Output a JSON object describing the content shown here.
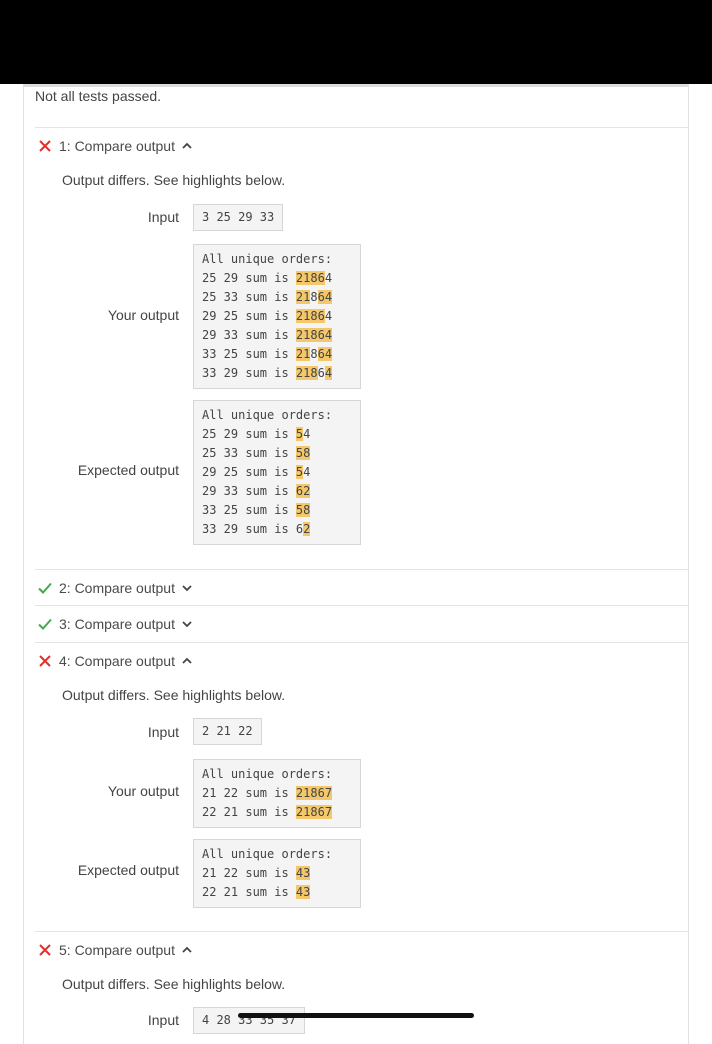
{
  "summary": "Not all tests passed.",
  "note_text": "Output differs. See highlights below.",
  "labels": {
    "input": "Input",
    "your_output": "Your output",
    "expected_output": "Expected output"
  },
  "colors": {
    "fail": "#e0302c",
    "pass": "#3fae4a",
    "highlight": "#f4c86a"
  },
  "tests": [
    {
      "title": "1: Compare output",
      "status": "fail",
      "expanded": true,
      "input": "3 25 29 33",
      "your_output": [
        [
          [
            "All unique orders:",
            0
          ]
        ],
        [
          [
            "25 29 sum is ",
            0
          ],
          [
            "2186",
            1
          ],
          [
            "4",
            0
          ]
        ],
        [
          [
            "25 33 sum is ",
            0
          ],
          [
            "21",
            1
          ],
          [
            "8",
            0
          ],
          [
            "64",
            1
          ]
        ],
        [
          [
            "29 25 sum is ",
            0
          ],
          [
            "2186",
            1
          ],
          [
            "4",
            0
          ]
        ],
        [
          [
            "29 33 sum is ",
            0
          ],
          [
            "2186",
            1
          ],
          [
            "4",
            1
          ]
        ],
        [
          [
            "33 25 sum is ",
            0
          ],
          [
            "21",
            1
          ],
          [
            "8",
            0
          ],
          [
            "64",
            1
          ]
        ],
        [
          [
            "33 29 sum is ",
            0
          ],
          [
            "218",
            1
          ],
          [
            "6",
            0
          ],
          [
            "4",
            1
          ]
        ]
      ],
      "expected_output": [
        [
          [
            "All unique orders:",
            0
          ]
        ],
        [
          [
            "25 29 sum is ",
            0
          ],
          [
            "5",
            1
          ],
          [
            "4",
            0
          ]
        ],
        [
          [
            "25 33 sum is ",
            0
          ],
          [
            "5",
            1
          ],
          [
            "8",
            1
          ]
        ],
        [
          [
            "29 25 sum is ",
            0
          ],
          [
            "5",
            1
          ],
          [
            "4",
            0
          ]
        ],
        [
          [
            "29 33 sum is ",
            0
          ],
          [
            "6",
            1
          ],
          [
            "2",
            1
          ]
        ],
        [
          [
            "33 25 sum is ",
            0
          ],
          [
            "5",
            1
          ],
          [
            "8",
            1
          ]
        ],
        [
          [
            "33 29 sum is ",
            0
          ],
          [
            "6",
            0
          ],
          [
            "2",
            1
          ]
        ]
      ]
    },
    {
      "title": "2: Compare output",
      "status": "pass",
      "expanded": false
    },
    {
      "title": "3: Compare output",
      "status": "pass",
      "expanded": false
    },
    {
      "title": "4: Compare output",
      "status": "fail",
      "expanded": true,
      "input": "2 21 22",
      "your_output": [
        [
          [
            "All unique orders:",
            0
          ]
        ],
        [
          [
            "21 22 sum is ",
            0
          ],
          [
            "21867",
            1
          ]
        ],
        [
          [
            "22 21 sum is ",
            0
          ],
          [
            "21867",
            1
          ]
        ]
      ],
      "expected_output": [
        [
          [
            "All unique orders:",
            0
          ]
        ],
        [
          [
            "21 22 sum is ",
            0
          ],
          [
            "43",
            1
          ]
        ],
        [
          [
            "22 21 sum is ",
            0
          ],
          [
            "43",
            1
          ]
        ]
      ]
    },
    {
      "title": "5: Compare output",
      "status": "fail",
      "expanded": true,
      "input": "4 28 33 35 37"
    }
  ]
}
